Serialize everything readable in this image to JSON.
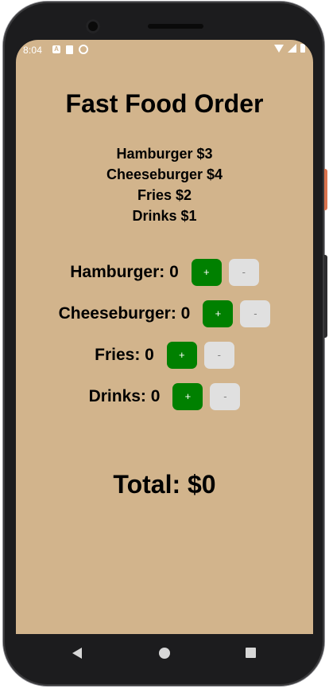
{
  "status_bar": {
    "time": "8:04",
    "app_icon_letter": "A",
    "left_icons": [
      "a-icon",
      "document-icon",
      "sync-icon"
    ],
    "right_icons": [
      "wifi-icon",
      "signal-icon",
      "battery-icon"
    ]
  },
  "title": "Fast Food Order",
  "menu": [
    {
      "label": "Hamburger $3"
    },
    {
      "label": "Cheeseburger $4"
    },
    {
      "label": "Fries $2"
    },
    {
      "label": "Drinks $1"
    }
  ],
  "orders": [
    {
      "label": "Hamburger: 0",
      "plus": "+",
      "minus": "-"
    },
    {
      "label": "Cheeseburger: 0",
      "plus": "+",
      "minus": "-"
    },
    {
      "label": "Fries: 0",
      "plus": "+",
      "minus": "-"
    },
    {
      "label": "Drinks: 0",
      "plus": "+",
      "minus": "-"
    }
  ],
  "total": "Total: $0",
  "nav_bar": {
    "icons": [
      "back-icon",
      "home-icon",
      "recents-icon"
    ]
  },
  "colors": {
    "background": "#d2b48c",
    "plus_button": "#008000",
    "minus_button": "#e0e0e0"
  }
}
